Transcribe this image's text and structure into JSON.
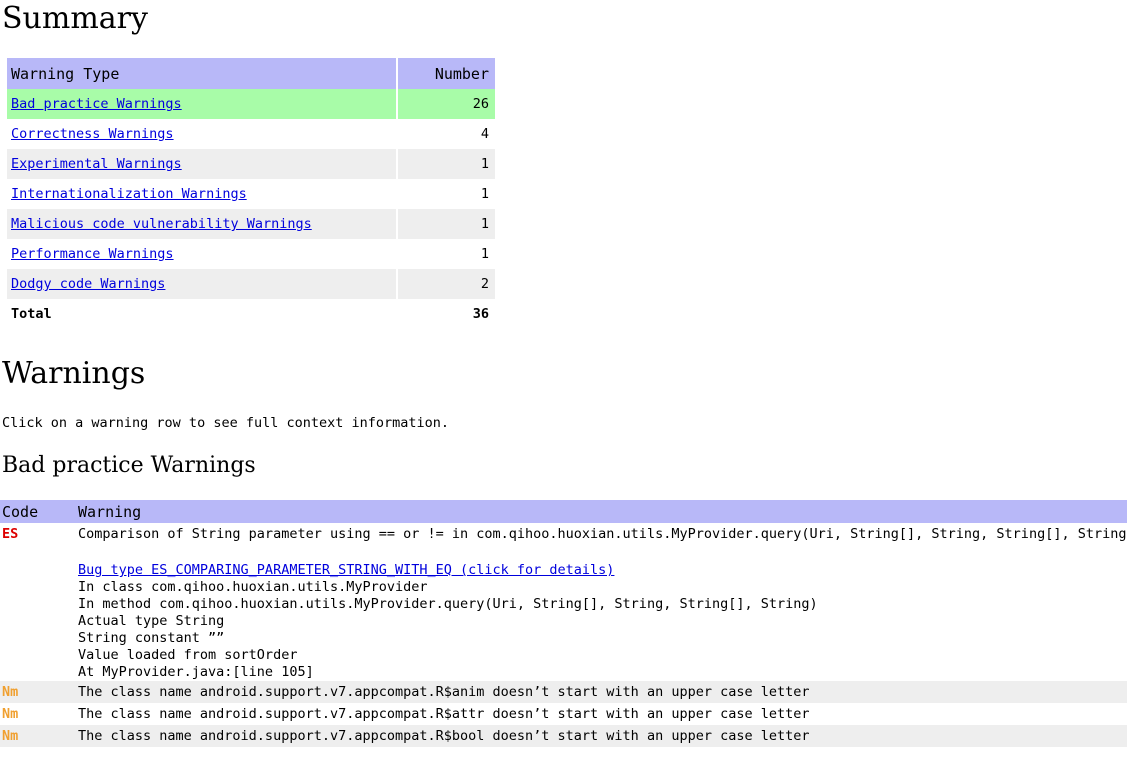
{
  "summary": {
    "heading": "Summary",
    "columns": [
      "Warning Type",
      "Number"
    ],
    "rows": [
      {
        "type": "Bad practice Warnings",
        "number": "26",
        "highlighted": true,
        "link": true
      },
      {
        "type": "Correctness Warnings",
        "number": "4",
        "highlighted": false,
        "link": true
      },
      {
        "type": "Experimental Warnings",
        "number": "1",
        "highlighted": false,
        "link": true
      },
      {
        "type": "Internationalization Warnings",
        "number": "1",
        "highlighted": false,
        "link": true
      },
      {
        "type": "Malicious code vulnerability Warnings",
        "number": "1",
        "highlighted": false,
        "link": true
      },
      {
        "type": "Performance Warnings",
        "number": "1",
        "highlighted": false,
        "link": true
      },
      {
        "type": "Dodgy code Warnings",
        "number": "2",
        "highlighted": false,
        "link": true
      }
    ],
    "total_label": "Total",
    "total_number": "36"
  },
  "warnings": {
    "heading": "Warnings",
    "hint": "Click on a warning row to see full context information.",
    "section_title": "Bad practice Warnings",
    "columns": [
      "Code",
      "Warning"
    ],
    "rows": [
      {
        "code": "ES",
        "code_style": "es",
        "text": "Comparison of String parameter using == or != in com.qihoo.huoxian.utils.MyProvider.query(Uri, String[], String, String[], String)",
        "expanded": true,
        "details": {
          "bug_type_link": "Bug type ES_COMPARING_PARAMETER_STRING_WITH_EQ (click for details)",
          "lines": [
            "In class com.qihoo.huoxian.utils.MyProvider",
            "In method com.qihoo.huoxian.utils.MyProvider.query(Uri, String[], String, String[], String)",
            "Actual type String",
            "String constant ””",
            "Value loaded from sortOrder",
            "At MyProvider.java:[line 105]"
          ]
        }
      },
      {
        "code": "Nm",
        "code_style": "nm",
        "text": "The class name android.support.v7.appcompat.R$anim doesn’t start with an upper case letter",
        "expanded": false
      },
      {
        "code": "Nm",
        "code_style": "nm",
        "text": "The class name android.support.v7.appcompat.R$attr doesn’t start with an upper case letter",
        "expanded": false
      },
      {
        "code": "Nm",
        "code_style": "nm",
        "text": "The class name android.support.v7.appcompat.R$bool doesn’t start with an upper case letter",
        "expanded": false
      }
    ]
  },
  "colors": {
    "header_purple": "#b8b8f8",
    "highlight_green": "#a8fca8",
    "stripe_gray": "#eeeeee",
    "link_blue": "#0000dd",
    "code_es_red": "#dd0000",
    "code_nm_orange": "#f0a030"
  }
}
